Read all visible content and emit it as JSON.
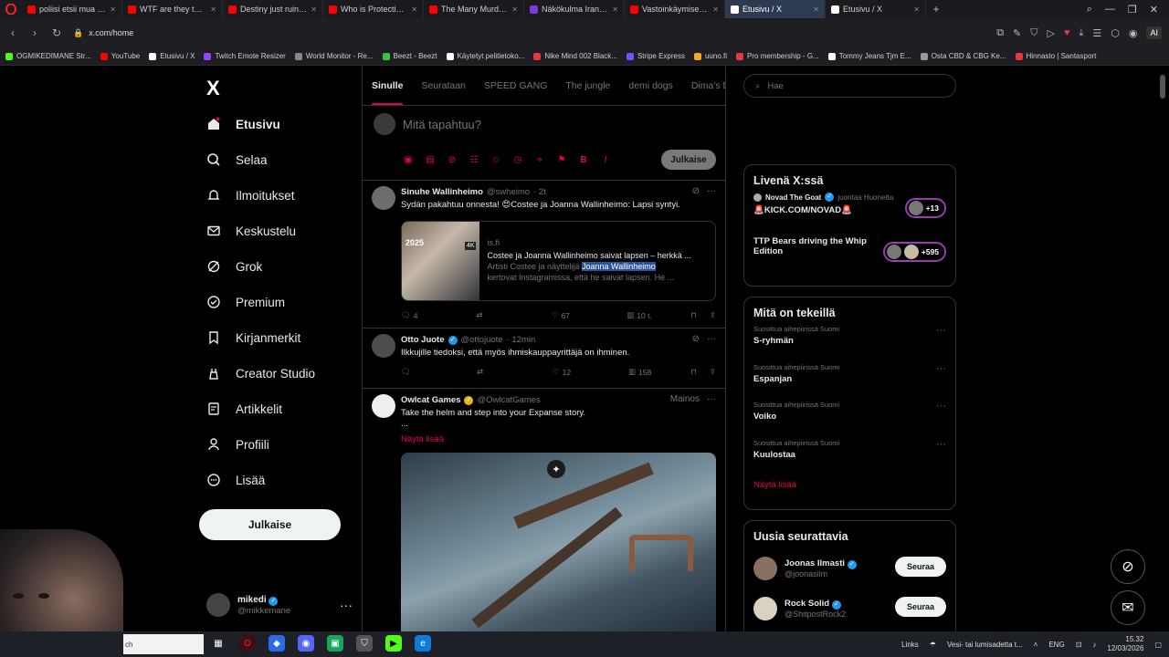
{
  "browser": {
    "tabs": [
      {
        "label": "poliisi etsii mua - YouTube",
        "color": "#ff0000"
      },
      {
        "label": "WTF are they thinking? - Y",
        "color": "#ff0000"
      },
      {
        "label": "Destiny just ruined his ca",
        "color": "#ff0000"
      },
      {
        "label": "Who is Protecting the Jeff",
        "color": "#ff0000"
      },
      {
        "label": "The Many Murders of Jeffr",
        "color": "#ff0000"
      },
      {
        "label": "Näkökulma Iranin tapaht",
        "color": "#7a3ad8"
      },
      {
        "label": "Vastoinkäymiset, UFC-uni",
        "color": "#ff0000"
      },
      {
        "label": "Etusivu / X",
        "color": "#ffffff"
      },
      {
        "label": "Etusivu / X",
        "color": "#ffffff"
      }
    ],
    "url": "x.com/home",
    "ai_label": "AI",
    "bookmarks": [
      {
        "label": "OGMIKEDIMANE Str...",
        "color": "#53fc18"
      },
      {
        "label": "YouTube",
        "color": "#ff0000"
      },
      {
        "label": "Etusivu / X",
        "color": "#ffffff"
      },
      {
        "label": "Twitch Emote Resizer",
        "color": "#9147ff"
      },
      {
        "label": "World Monitor - Re...",
        "color": "#888888"
      },
      {
        "label": "Beezt - Beezt",
        "color": "#37c23f"
      },
      {
        "label": "Käytetyt pelitietoko...",
        "color": "#ffffff"
      },
      {
        "label": "Nike Mind 002 Black...",
        "color": "#e23b3b"
      },
      {
        "label": "Stripe Express",
        "color": "#635bff"
      },
      {
        "label": "uuno.fi",
        "color": "#f5a623"
      },
      {
        "label": "Pro membership - G...",
        "color": "#e23b3b"
      },
      {
        "label": "Tommy Jeans Tjm E...",
        "color": "#ffffff"
      },
      {
        "label": "Osta CBD & CBG Ke...",
        "color": "#999999"
      },
      {
        "label": "Hinnasto | Santasport",
        "color": "#e23b3b"
      }
    ]
  },
  "sidebar": {
    "logo": "X",
    "items": [
      {
        "label": "Etusivu"
      },
      {
        "label": "Selaa"
      },
      {
        "label": "Ilmoitukset"
      },
      {
        "label": "Keskustelu"
      },
      {
        "label": "Grok"
      },
      {
        "label": "Premium"
      },
      {
        "label": "Kirjanmerkit"
      },
      {
        "label": "Creator Studio"
      },
      {
        "label": "Artikkelit"
      },
      {
        "label": "Profiili"
      },
      {
        "label": "Lisää"
      }
    ],
    "post_button": "Julkaise",
    "account": {
      "name": "mikedi",
      "handle": "@mikkemane"
    }
  },
  "main": {
    "tabs": [
      "Sinulle",
      "Seurataan",
      "SPEED GANG",
      "The jungle",
      "demi dogs",
      "Dima's Dist"
    ],
    "composer": {
      "placeholder": "Mitä tapahtuu?",
      "post_label": "Julkaise"
    },
    "tweets": [
      {
        "name": "Sinuhe Wallinheimo",
        "handle": "@swheimo",
        "time": "· 2t",
        "text": "Sydän pakahtuu onnesta! 😍Costee ja Joanna Wallinheimo: Lapsi syntyi.",
        "card": {
          "year": "2025",
          "badge": "4K",
          "source": "is.fi",
          "title": "Costee ja Joanna Wallinheimo saivat lapsen – herkkä ...",
          "desc_prefix": "Artisti Costee ja näyttelijä ",
          "desc_highlight": "Joanna Wallinheimo",
          "desc_line2": "kertovat Instagramissa, että he saivat lapsen. He ..."
        },
        "stats": {
          "replies": "4",
          "reposts": "",
          "likes": "67",
          "views": "10 t."
        }
      },
      {
        "name": "Otto Juote",
        "handle": "@ottojuote",
        "time": "· 12min",
        "text": "Ilkkujille tiedoksi, että myös ihmiskauppayrittäjä on ihminen.",
        "stats": {
          "replies": "",
          "reposts": "",
          "likes": "12",
          "views": "158"
        }
      },
      {
        "name": "Owlcat Games",
        "handle": "@OwlcatGames",
        "ad_label": "Mainos",
        "text": "Take the helm and step into your Expanse story.",
        "text2": "...",
        "show_more": "Näytä lisää"
      }
    ]
  },
  "right": {
    "search_placeholder": "Hae",
    "live": {
      "title": "Livenä X:ssä",
      "items": [
        {
          "host": "Novad The Goat",
          "action": "juontaa Huonetta",
          "title": "🚨KICK.COM/NOVAD🚨",
          "count": "+13"
        },
        {
          "host": "",
          "action": "",
          "title": "TTP Bears driving the Whip Edition",
          "count": "+595"
        }
      ]
    },
    "trends": {
      "title": "Mitä on tekeillä",
      "items": [
        {
          "context": "Suosittua aihepiirissä Suomi",
          "name": "S-ryhmän"
        },
        {
          "context": "Suosittua aihepiirissä Suomi",
          "name": "Espanjan"
        },
        {
          "context": "Suosittua aihepiirissä Suomi",
          "name": "Voiko"
        },
        {
          "context": "Suosittua aihepiirissä Suomi",
          "name": "Kuulostaa"
        }
      ],
      "more": "Näytä lisää"
    },
    "follow": {
      "title": "Uusia seurattavia",
      "items": [
        {
          "name": "Joonas Ilmasti",
          "handle": "@joonasilm",
          "button": "Seuraa"
        },
        {
          "name": "Rock Solid",
          "handle": "@ShitpostRock2",
          "button": "Seuraa"
        }
      ]
    }
  },
  "taskbar": {
    "search_text": "ch",
    "links_label": "Links",
    "weather": "Vesi- tai lumisadetta t...",
    "lang": "ENG",
    "time": "15.32",
    "date": "12/03/2026"
  }
}
